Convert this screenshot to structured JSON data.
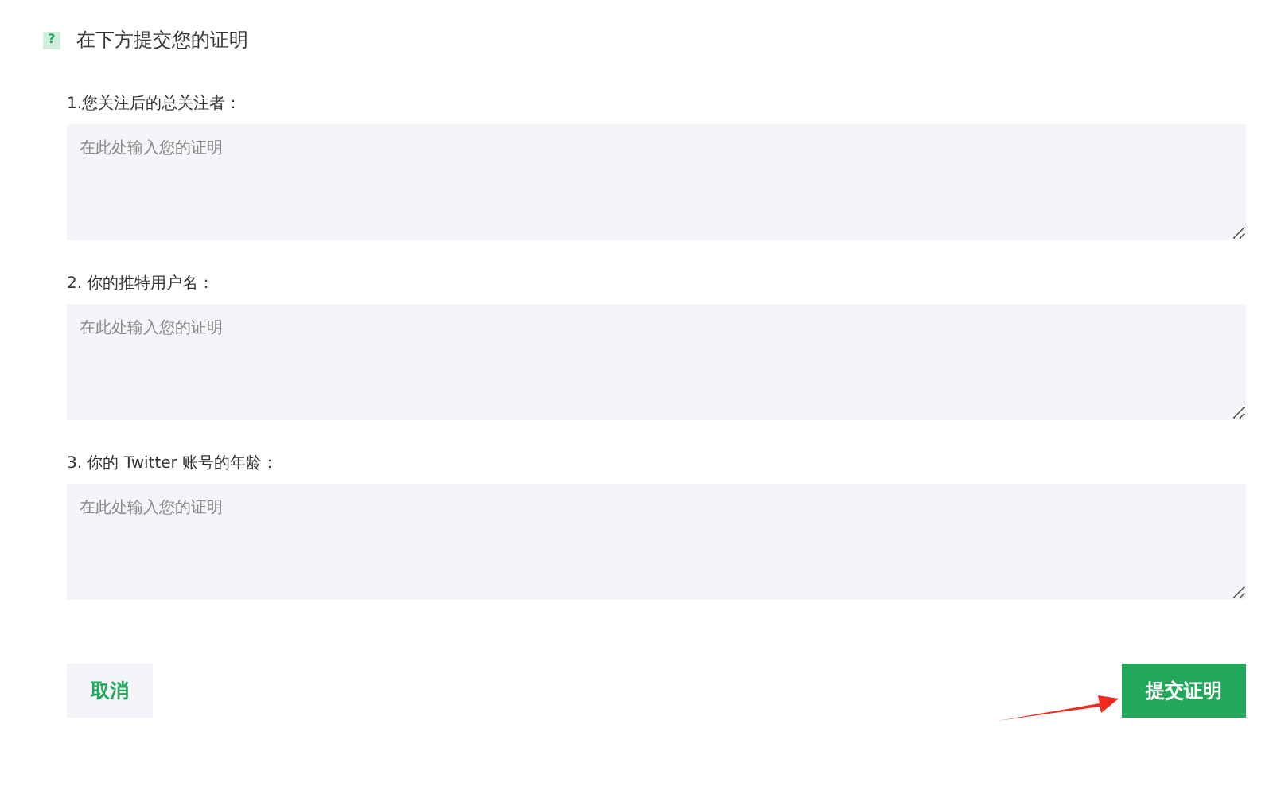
{
  "header": {
    "icon": "?",
    "title": "在下方提交您的证明"
  },
  "questions": [
    {
      "label": "1.您关注后的总关注者：",
      "placeholder": "在此处输入您的证明"
    },
    {
      "label": "2. 你的推特用户名：",
      "placeholder": "在此处输入您的证明"
    },
    {
      "label": "3. 你的 Twitter 账号的年龄：",
      "placeholder": "在此处输入您的证明"
    }
  ],
  "buttons": [
    {
      "label": "取消",
      "kind": "secondary"
    },
    {
      "label": "提交证明",
      "kind": "primary"
    }
  ]
}
